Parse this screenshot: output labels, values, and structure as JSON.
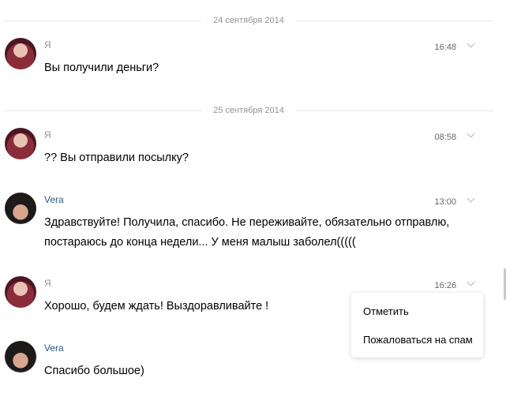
{
  "dates": [
    "24 сентября 2014",
    "25 сентября 2014"
  ],
  "messages": [
    {
      "author": "Я",
      "time": "16:48",
      "text": "Вы получили деньги?"
    },
    {
      "author": "Я",
      "time": "08:58",
      "text": "?? Вы отправили посылку?"
    },
    {
      "author": "Vera",
      "time": "13:00",
      "text": "Здравствуйте! Получила, спасибо. Не переживайте, обязательно отправлю, постараюсь до конца недели... У меня малыш заболел((((("
    },
    {
      "author": "Я",
      "time": "16:26",
      "text": "Хорошо, будем ждать! Выздоравливайте !"
    },
    {
      "author": "Vera",
      "time": "",
      "text": "Спасибо большое)"
    }
  ],
  "menu": {
    "mark": "Отметить",
    "spam": "Пожаловаться на спам"
  },
  "colors": {
    "link": "#2a5885",
    "meta": "#939393",
    "divider": "#e7e8ec"
  },
  "icons": {
    "message_menu": "chevron-down-icon"
  }
}
